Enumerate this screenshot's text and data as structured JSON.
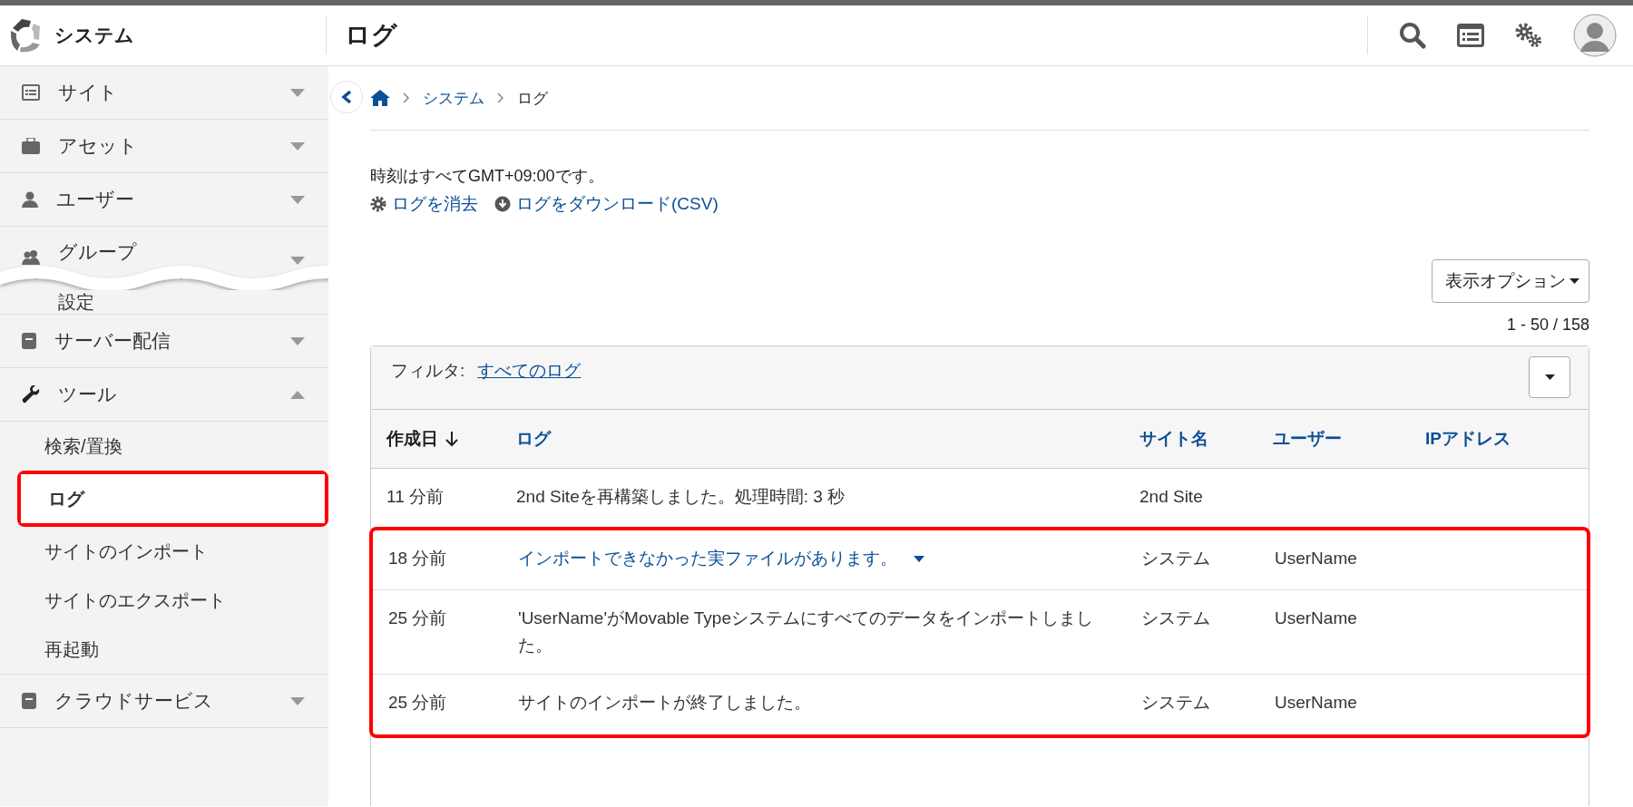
{
  "header": {
    "app_name": "システム",
    "title": "ログ"
  },
  "sidebar": {
    "items": [
      {
        "label": "サイト",
        "expanded": false
      },
      {
        "label": "アセット",
        "expanded": false
      },
      {
        "label": "ユーザー",
        "expanded": false
      },
      {
        "label": "グループ",
        "expanded": false,
        "kind": "cut_top"
      },
      {
        "label": "設定",
        "kind": "cut_bottom"
      },
      {
        "label": "サーバー配信",
        "expanded": false
      },
      {
        "label": "ツール",
        "expanded": true,
        "children": [
          {
            "label": "検索/置換",
            "selected": false,
            "highlighted": false
          },
          {
            "label": "ログ",
            "selected": true,
            "highlighted": true
          },
          {
            "label": "サイトのインポート",
            "selected": false,
            "highlighted": false
          },
          {
            "label": "サイトのエクスポート",
            "selected": false,
            "highlighted": false
          },
          {
            "label": "再起動",
            "selected": false,
            "highlighted": false
          }
        ]
      },
      {
        "label": "クラウドサービス",
        "expanded": false
      }
    ]
  },
  "breadcrumb": [
    "システム",
    "ログ"
  ],
  "notice": "時刻はすべてGMT+09:00です。",
  "actions": [
    {
      "label": "ログを消去"
    },
    {
      "label": "ログをダウンロード(CSV)"
    }
  ],
  "display_options": "表示オプション",
  "count": "1 - 50 / 158",
  "filter": {
    "label": "フィルタ:",
    "value": "すべてのログ"
  },
  "table": {
    "columns": [
      {
        "label": "作成日",
        "sorted": true
      },
      {
        "label": "ログ",
        "sorted": false
      },
      {
        "label": "サイト名",
        "sorted": false
      },
      {
        "label": "ユーザー",
        "sorted": false
      },
      {
        "label": "IPアドレス",
        "sorted": false
      }
    ],
    "rows": [
      {
        "created": "11 分前",
        "log": "2nd Siteを再構築しました。処理時間: 3 秒",
        "kind": "text",
        "site": "2nd Site",
        "highlighted": false
      },
      {
        "created": "18 分前",
        "log": "インポートできなかった実ファイルがあります。",
        "kind": "link",
        "site": "システム",
        "user": "UserName",
        "highlighted": true
      },
      {
        "created": "25 分前",
        "log": "'UserName'がMovable Typeシステムにすべてのデータをインポートしました。",
        "kind": "text",
        "site": "システム",
        "user": "UserName",
        "highlighted": true
      },
      {
        "created": "25 分前",
        "log": "サイトのインポートが終了しました。",
        "kind": "text",
        "site": "システム",
        "user": "UserName",
        "highlighted": true
      }
    ]
  }
}
